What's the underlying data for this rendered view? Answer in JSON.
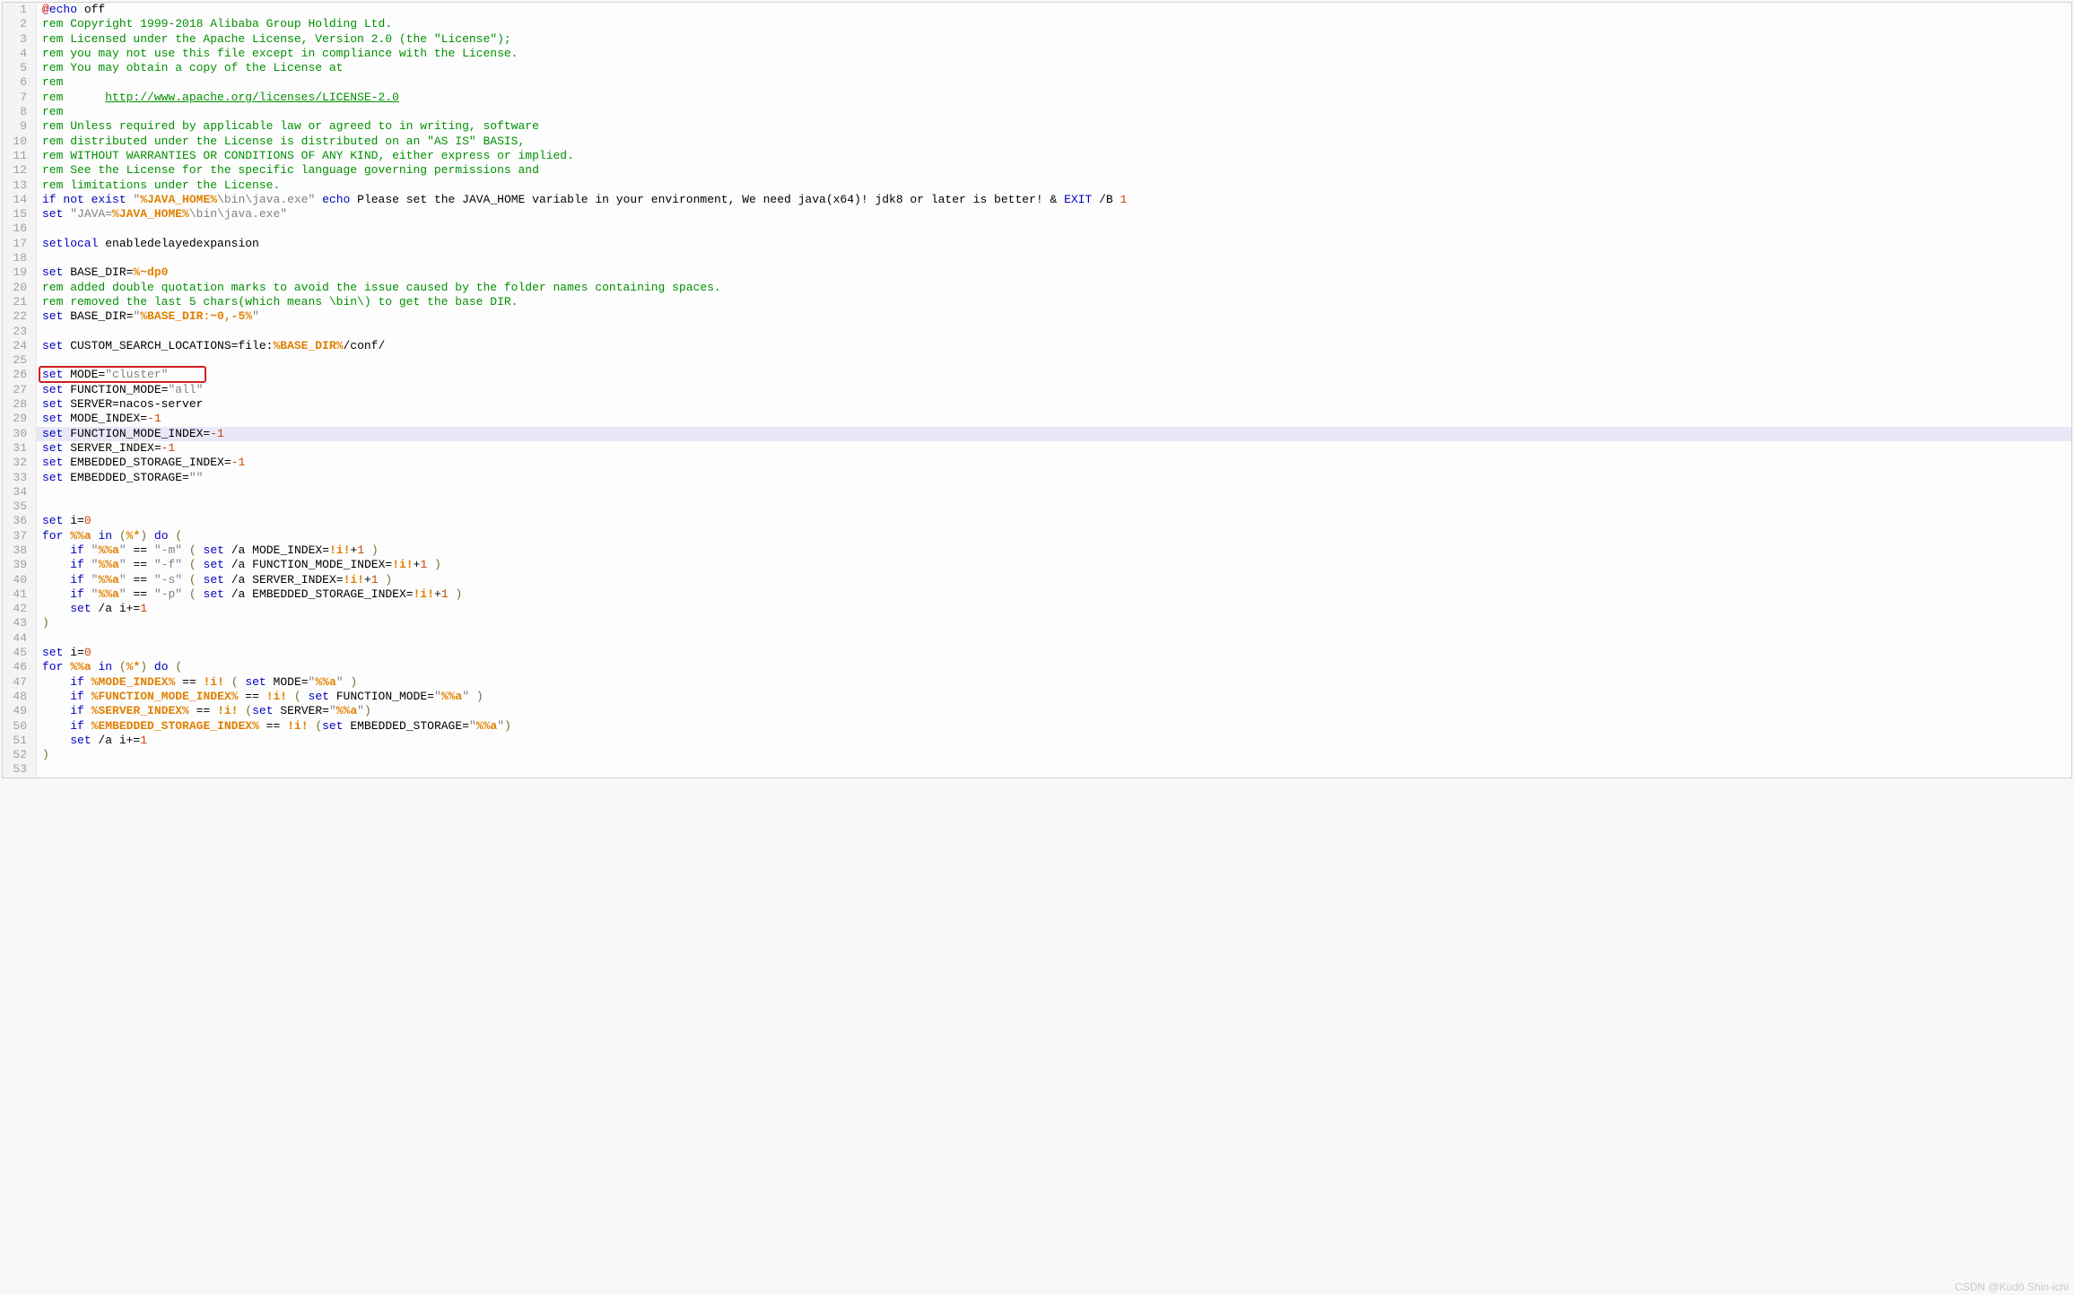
{
  "watermark": "CSDN @Kudō Shin-ichi",
  "lines": [
    {
      "n": 1,
      "seg": [
        {
          "t": "@",
          "c": "caret"
        },
        {
          "t": "echo",
          "c": "kw"
        },
        {
          "t": " off"
        }
      ]
    },
    {
      "n": 2,
      "seg": [
        {
          "t": "rem Copyright 1999-2018 Alibaba Group Holding Ltd.",
          "c": "rem"
        }
      ]
    },
    {
      "n": 3,
      "seg": [
        {
          "t": "rem Licensed under the Apache License, Version 2.0 (the \"License\");",
          "c": "rem"
        }
      ]
    },
    {
      "n": 4,
      "seg": [
        {
          "t": "rem you may not use this file except in compliance with the License.",
          "c": "rem"
        }
      ]
    },
    {
      "n": 5,
      "seg": [
        {
          "t": "rem You may obtain a copy of the License at",
          "c": "rem"
        }
      ]
    },
    {
      "n": 6,
      "seg": [
        {
          "t": "rem",
          "c": "rem"
        }
      ]
    },
    {
      "n": 7,
      "seg": [
        {
          "t": "rem      ",
          "c": "rem"
        },
        {
          "t": "http://www.apache.org/licenses/LICENSE-2.0",
          "c": "link"
        }
      ]
    },
    {
      "n": 8,
      "seg": [
        {
          "t": "rem",
          "c": "rem"
        }
      ]
    },
    {
      "n": 9,
      "seg": [
        {
          "t": "rem Unless required by applicable law or agreed to in writing, software",
          "c": "rem"
        }
      ]
    },
    {
      "n": 10,
      "seg": [
        {
          "t": "rem distributed under the License is distributed on an \"AS IS\" BASIS,",
          "c": "rem"
        }
      ]
    },
    {
      "n": 11,
      "seg": [
        {
          "t": "rem WITHOUT WARRANTIES OR CONDITIONS OF ANY KIND, either express or implied.",
          "c": "rem"
        }
      ]
    },
    {
      "n": 12,
      "seg": [
        {
          "t": "rem See the License for the specific language governing permissions and",
          "c": "rem"
        }
      ]
    },
    {
      "n": 13,
      "seg": [
        {
          "t": "rem limitations under the License.",
          "c": "rem"
        }
      ]
    },
    {
      "n": 14,
      "seg": [
        {
          "t": "if not exist",
          "c": "kw"
        },
        {
          "t": " "
        },
        {
          "t": "\"",
          "c": "str"
        },
        {
          "t": "%JAVA_HOME%",
          "c": "var"
        },
        {
          "t": "\\bin\\java.exe\"",
          "c": "str"
        },
        {
          "t": " "
        },
        {
          "t": "echo",
          "c": "kw"
        },
        {
          "t": " Please set the JAVA_HOME variable in your environment, We need java(x64)! jdk8 or later is better! & "
        },
        {
          "t": "EXIT",
          "c": "kw"
        },
        {
          "t": " /B "
        },
        {
          "t": "1",
          "c": "num"
        }
      ]
    },
    {
      "n": 15,
      "seg": [
        {
          "t": "set",
          "c": "kw"
        },
        {
          "t": " "
        },
        {
          "t": "\"JAVA=",
          "c": "str"
        },
        {
          "t": "%JAVA_HOME%",
          "c": "var"
        },
        {
          "t": "\\bin\\java.exe\"",
          "c": "str"
        }
      ]
    },
    {
      "n": 16,
      "seg": []
    },
    {
      "n": 17,
      "seg": [
        {
          "t": "setlocal",
          "c": "kw"
        },
        {
          "t": " enabledelayedexpansion"
        }
      ]
    },
    {
      "n": 18,
      "seg": []
    },
    {
      "n": 19,
      "seg": [
        {
          "t": "set",
          "c": "kw"
        },
        {
          "t": " BASE_DIR="
        },
        {
          "t": "%~dp0",
          "c": "var"
        }
      ]
    },
    {
      "n": 20,
      "seg": [
        {
          "t": "rem added double quotation marks to avoid the issue caused by the folder names containing spaces.",
          "c": "rem"
        }
      ]
    },
    {
      "n": 21,
      "seg": [
        {
          "t": "rem removed the last 5 chars(which means \\bin\\) to get the base DIR.",
          "c": "rem"
        }
      ]
    },
    {
      "n": 22,
      "seg": [
        {
          "t": "set",
          "c": "kw"
        },
        {
          "t": " BASE_DIR="
        },
        {
          "t": "\"",
          "c": "str"
        },
        {
          "t": "%BASE_DIR:~0,-5%",
          "c": "var"
        },
        {
          "t": "\"",
          "c": "str"
        }
      ]
    },
    {
      "n": 23,
      "seg": []
    },
    {
      "n": 24,
      "seg": [
        {
          "t": "set",
          "c": "kw"
        },
        {
          "t": " CUSTOM_SEARCH_LOCATIONS=file:"
        },
        {
          "t": "%BASE_DIR%",
          "c": "var"
        },
        {
          "t": "/conf/"
        }
      ]
    },
    {
      "n": 25,
      "seg": []
    },
    {
      "n": 26,
      "box": true,
      "seg": [
        {
          "t": "set",
          "c": "kw"
        },
        {
          "t": " MODE="
        },
        {
          "t": "\"cluster\"",
          "c": "str"
        }
      ]
    },
    {
      "n": 27,
      "seg": [
        {
          "t": "set",
          "c": "kw"
        },
        {
          "t": " FUNCTION_MODE="
        },
        {
          "t": "\"all\"",
          "c": "str"
        }
      ]
    },
    {
      "n": 28,
      "seg": [
        {
          "t": "set",
          "c": "kw"
        },
        {
          "t": " SERVER=nacos-server"
        }
      ]
    },
    {
      "n": 29,
      "seg": [
        {
          "t": "set",
          "c": "kw"
        },
        {
          "t": " MODE_INDEX="
        },
        {
          "t": "-1",
          "c": "num"
        }
      ]
    },
    {
      "n": 30,
      "hl": true,
      "seg": [
        {
          "t": "set",
          "c": "kw"
        },
        {
          "t": " FUNCTION_MODE_INDEX="
        },
        {
          "t": "-1",
          "c": "num"
        }
      ]
    },
    {
      "n": 31,
      "seg": [
        {
          "t": "set",
          "c": "kw"
        },
        {
          "t": " SERVER_INDEX="
        },
        {
          "t": "-1",
          "c": "num"
        }
      ]
    },
    {
      "n": 32,
      "seg": [
        {
          "t": "set",
          "c": "kw"
        },
        {
          "t": " EMBEDDED_STORAGE_INDEX="
        },
        {
          "t": "-1",
          "c": "num"
        }
      ]
    },
    {
      "n": 33,
      "seg": [
        {
          "t": "set",
          "c": "kw"
        },
        {
          "t": " EMBEDDED_STORAGE="
        },
        {
          "t": "\"\"",
          "c": "str"
        }
      ]
    },
    {
      "n": 34,
      "seg": []
    },
    {
      "n": 35,
      "seg": []
    },
    {
      "n": 36,
      "seg": [
        {
          "t": "set",
          "c": "kw"
        },
        {
          "t": " i="
        },
        {
          "t": "0",
          "c": "num"
        }
      ]
    },
    {
      "n": 37,
      "seg": [
        {
          "t": "for",
          "c": "kw"
        },
        {
          "t": " "
        },
        {
          "t": "%%a",
          "c": "var"
        },
        {
          "t": " "
        },
        {
          "t": "in",
          "c": "kw"
        },
        {
          "t": " "
        },
        {
          "t": "(",
          "c": "paren"
        },
        {
          "t": "%*",
          "c": "var"
        },
        {
          "t": ")",
          "c": "paren"
        },
        {
          "t": " "
        },
        {
          "t": "do",
          "c": "kw"
        },
        {
          "t": " "
        },
        {
          "t": "(",
          "c": "paren"
        }
      ]
    },
    {
      "n": 38,
      "seg": [
        {
          "t": "    "
        },
        {
          "t": "if",
          "c": "kw"
        },
        {
          "t": " "
        },
        {
          "t": "\"",
          "c": "str"
        },
        {
          "t": "%%a",
          "c": "var"
        },
        {
          "t": "\"",
          "c": "str"
        },
        {
          "t": " == "
        },
        {
          "t": "\"-m\"",
          "c": "str"
        },
        {
          "t": " "
        },
        {
          "t": "(",
          "c": "paren"
        },
        {
          "t": " "
        },
        {
          "t": "set",
          "c": "kw"
        },
        {
          "t": " /a MODE_INDEX="
        },
        {
          "t": "!i!",
          "c": "var"
        },
        {
          "t": "+"
        },
        {
          "t": "1",
          "c": "num"
        },
        {
          "t": " "
        },
        {
          "t": ")",
          "c": "paren"
        }
      ]
    },
    {
      "n": 39,
      "seg": [
        {
          "t": "    "
        },
        {
          "t": "if",
          "c": "kw"
        },
        {
          "t": " "
        },
        {
          "t": "\"",
          "c": "str"
        },
        {
          "t": "%%a",
          "c": "var"
        },
        {
          "t": "\"",
          "c": "str"
        },
        {
          "t": " == "
        },
        {
          "t": "\"-f\"",
          "c": "str"
        },
        {
          "t": " "
        },
        {
          "t": "(",
          "c": "paren"
        },
        {
          "t": " "
        },
        {
          "t": "set",
          "c": "kw"
        },
        {
          "t": " /a FUNCTION_MODE_INDEX="
        },
        {
          "t": "!i!",
          "c": "var"
        },
        {
          "t": "+"
        },
        {
          "t": "1",
          "c": "num"
        },
        {
          "t": " "
        },
        {
          "t": ")",
          "c": "paren"
        }
      ]
    },
    {
      "n": 40,
      "seg": [
        {
          "t": "    "
        },
        {
          "t": "if",
          "c": "kw"
        },
        {
          "t": " "
        },
        {
          "t": "\"",
          "c": "str"
        },
        {
          "t": "%%a",
          "c": "var"
        },
        {
          "t": "\"",
          "c": "str"
        },
        {
          "t": " == "
        },
        {
          "t": "\"-s\"",
          "c": "str"
        },
        {
          "t": " "
        },
        {
          "t": "(",
          "c": "paren"
        },
        {
          "t": " "
        },
        {
          "t": "set",
          "c": "kw"
        },
        {
          "t": " /a SERVER_INDEX="
        },
        {
          "t": "!i!",
          "c": "var"
        },
        {
          "t": "+"
        },
        {
          "t": "1",
          "c": "num"
        },
        {
          "t": " "
        },
        {
          "t": ")",
          "c": "paren"
        }
      ]
    },
    {
      "n": 41,
      "seg": [
        {
          "t": "    "
        },
        {
          "t": "if",
          "c": "kw"
        },
        {
          "t": " "
        },
        {
          "t": "\"",
          "c": "str"
        },
        {
          "t": "%%a",
          "c": "var"
        },
        {
          "t": "\"",
          "c": "str"
        },
        {
          "t": " == "
        },
        {
          "t": "\"-p\"",
          "c": "str"
        },
        {
          "t": " "
        },
        {
          "t": "(",
          "c": "paren"
        },
        {
          "t": " "
        },
        {
          "t": "set",
          "c": "kw"
        },
        {
          "t": " /a EMBEDDED_STORAGE_INDEX="
        },
        {
          "t": "!i!",
          "c": "var"
        },
        {
          "t": "+"
        },
        {
          "t": "1",
          "c": "num"
        },
        {
          "t": " "
        },
        {
          "t": ")",
          "c": "paren"
        }
      ]
    },
    {
      "n": 42,
      "seg": [
        {
          "t": "    "
        },
        {
          "t": "set",
          "c": "kw"
        },
        {
          "t": " /a i+="
        },
        {
          "t": "1",
          "c": "num"
        }
      ]
    },
    {
      "n": 43,
      "seg": [
        {
          "t": ")",
          "c": "paren"
        }
      ]
    },
    {
      "n": 44,
      "seg": []
    },
    {
      "n": 45,
      "seg": [
        {
          "t": "set",
          "c": "kw"
        },
        {
          "t": " i="
        },
        {
          "t": "0",
          "c": "num"
        }
      ]
    },
    {
      "n": 46,
      "seg": [
        {
          "t": "for",
          "c": "kw"
        },
        {
          "t": " "
        },
        {
          "t": "%%a",
          "c": "var"
        },
        {
          "t": " "
        },
        {
          "t": "in",
          "c": "kw"
        },
        {
          "t": " "
        },
        {
          "t": "(",
          "c": "paren"
        },
        {
          "t": "%*",
          "c": "var"
        },
        {
          "t": ")",
          "c": "paren"
        },
        {
          "t": " "
        },
        {
          "t": "do",
          "c": "kw"
        },
        {
          "t": " "
        },
        {
          "t": "(",
          "c": "paren"
        }
      ]
    },
    {
      "n": 47,
      "seg": [
        {
          "t": "    "
        },
        {
          "t": "if",
          "c": "kw"
        },
        {
          "t": " "
        },
        {
          "t": "%MODE_INDEX%",
          "c": "var"
        },
        {
          "t": " == "
        },
        {
          "t": "!i!",
          "c": "var"
        },
        {
          "t": " "
        },
        {
          "t": "(",
          "c": "paren"
        },
        {
          "t": " "
        },
        {
          "t": "set",
          "c": "kw"
        },
        {
          "t": " MODE="
        },
        {
          "t": "\"",
          "c": "str"
        },
        {
          "t": "%%a",
          "c": "var"
        },
        {
          "t": "\"",
          "c": "str"
        },
        {
          "t": " "
        },
        {
          "t": ")",
          "c": "paren"
        }
      ]
    },
    {
      "n": 48,
      "seg": [
        {
          "t": "    "
        },
        {
          "t": "if",
          "c": "kw"
        },
        {
          "t": " "
        },
        {
          "t": "%FUNCTION_MODE_INDEX%",
          "c": "var"
        },
        {
          "t": " == "
        },
        {
          "t": "!i!",
          "c": "var"
        },
        {
          "t": " "
        },
        {
          "t": "(",
          "c": "paren"
        },
        {
          "t": " "
        },
        {
          "t": "set",
          "c": "kw"
        },
        {
          "t": " FUNCTION_MODE="
        },
        {
          "t": "\"",
          "c": "str"
        },
        {
          "t": "%%a",
          "c": "var"
        },
        {
          "t": "\"",
          "c": "str"
        },
        {
          "t": " "
        },
        {
          "t": ")",
          "c": "paren"
        }
      ]
    },
    {
      "n": 49,
      "seg": [
        {
          "t": "    "
        },
        {
          "t": "if",
          "c": "kw"
        },
        {
          "t": " "
        },
        {
          "t": "%SERVER_INDEX%",
          "c": "var"
        },
        {
          "t": " == "
        },
        {
          "t": "!i!",
          "c": "var"
        },
        {
          "t": " "
        },
        {
          "t": "(",
          "c": "paren"
        },
        {
          "t": "set",
          "c": "kw"
        },
        {
          "t": " SERVER="
        },
        {
          "t": "\"",
          "c": "str"
        },
        {
          "t": "%%a",
          "c": "var"
        },
        {
          "t": "\"",
          "c": "str"
        },
        {
          "t": ")",
          "c": "paren"
        }
      ]
    },
    {
      "n": 50,
      "seg": [
        {
          "t": "    "
        },
        {
          "t": "if",
          "c": "kw"
        },
        {
          "t": " "
        },
        {
          "t": "%EMBEDDED_STORAGE_INDEX%",
          "c": "var"
        },
        {
          "t": " == "
        },
        {
          "t": "!i!",
          "c": "var"
        },
        {
          "t": " "
        },
        {
          "t": "(",
          "c": "paren"
        },
        {
          "t": "set",
          "c": "kw"
        },
        {
          "t": " EMBEDDED_STORAGE="
        },
        {
          "t": "\"",
          "c": "str"
        },
        {
          "t": "%%a",
          "c": "var"
        },
        {
          "t": "\"",
          "c": "str"
        },
        {
          "t": ")",
          "c": "paren"
        }
      ]
    },
    {
      "n": 51,
      "seg": [
        {
          "t": "    "
        },
        {
          "t": "set",
          "c": "kw"
        },
        {
          "t": " /a i+="
        },
        {
          "t": "1",
          "c": "num"
        }
      ]
    },
    {
      "n": 52,
      "seg": [
        {
          "t": ")",
          "c": "paren"
        }
      ]
    },
    {
      "n": 53,
      "seg": []
    }
  ]
}
